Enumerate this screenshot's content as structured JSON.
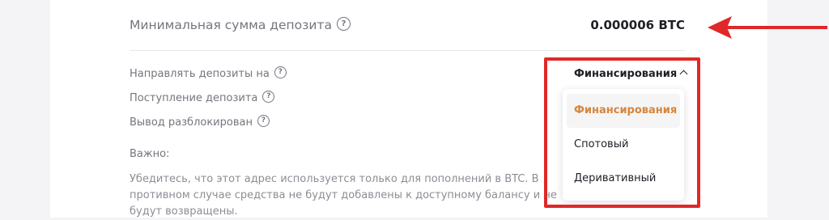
{
  "deposit": {
    "min_label": "Минимальная сумма депозита",
    "min_value": "0.000006 BTC"
  },
  "info": {
    "route_label": "Направлять депозиты на",
    "arrival_label": "Поступление депозита",
    "unlock_label": "Вывод разблокирован",
    "route_selected": "Финансирования"
  },
  "dropdown": {
    "options": [
      "Финансирования",
      "Спотовый",
      "Деривативный"
    ],
    "selected_index": 0
  },
  "notice": {
    "important_label": "Важно:",
    "text": "Убедитесь, что этот адрес используется только для пополнений в BTC. В противном случае средства не будут добавлены к доступному балансу и не будут возвращены."
  },
  "icons": {
    "help": "question-circle-icon",
    "chevron": "chevron-up-icon",
    "annotation_arrow": "arrow-left-icon"
  },
  "colors": {
    "accent_selected": "#d5863e",
    "annotation_red": "#e02828",
    "text_primary": "#1e2026",
    "text_secondary": "#73767d"
  }
}
